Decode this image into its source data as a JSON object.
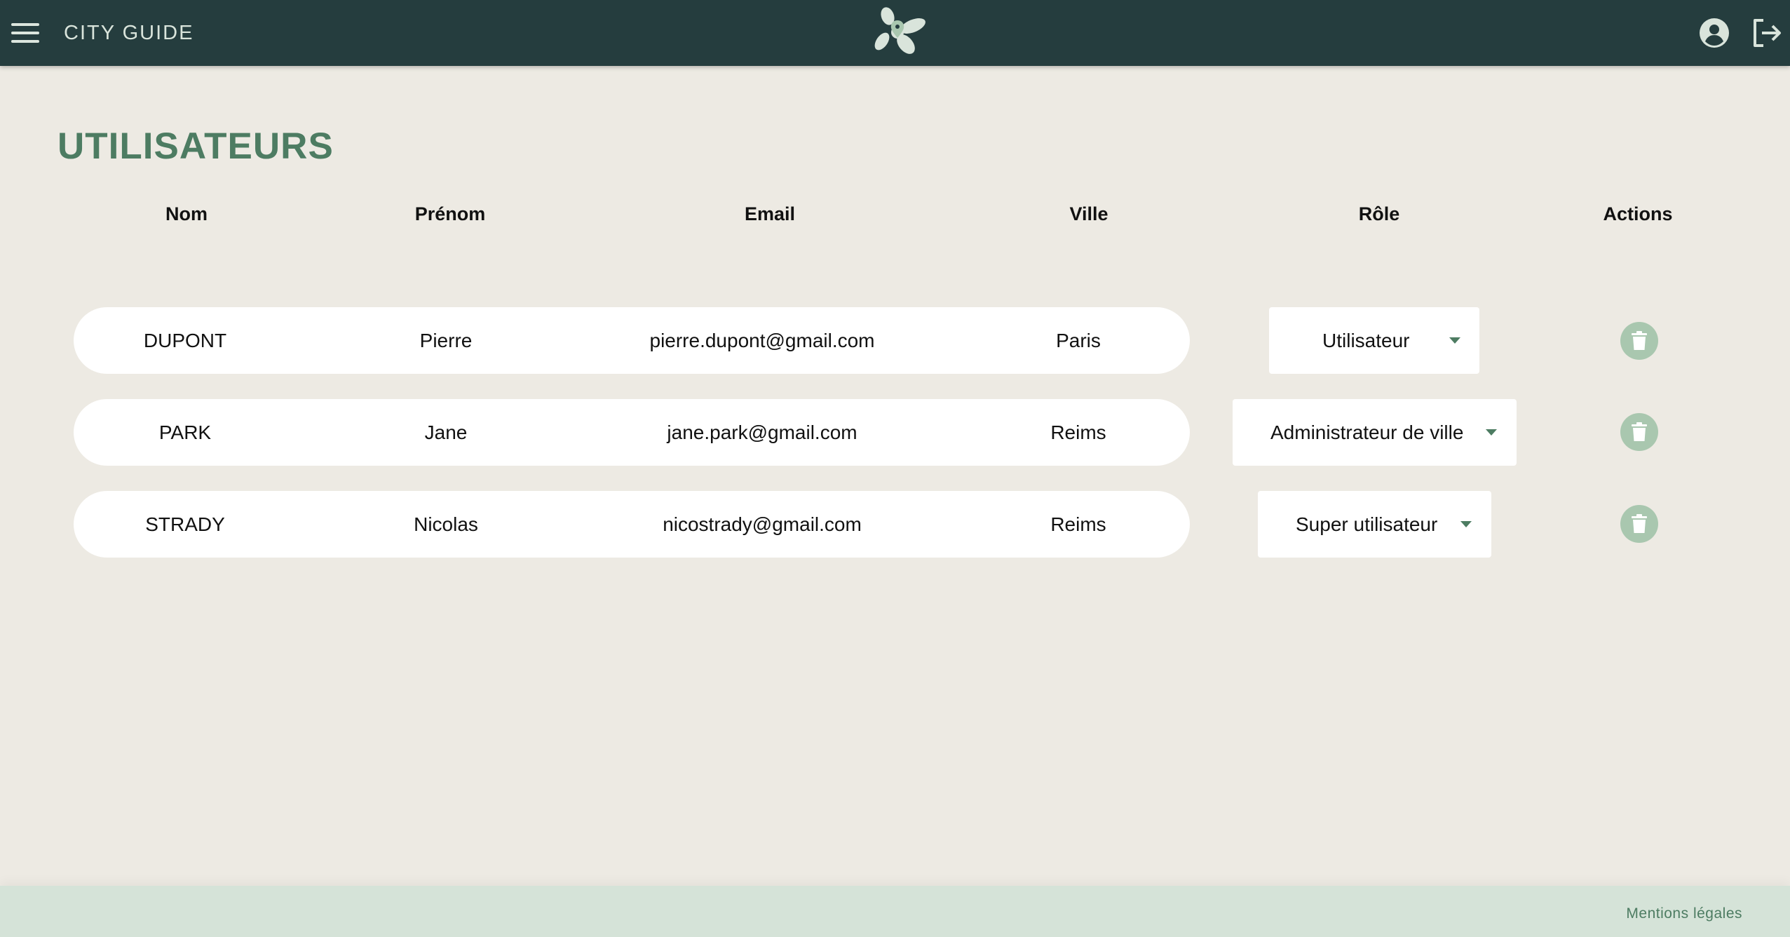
{
  "header": {
    "title": "CITY GUIDE",
    "menu_icon": "hamburger-icon",
    "logo_icon": "flower-pin-logo",
    "profile_icon": "user-circle-icon",
    "logout_icon": "logout-icon"
  },
  "page": {
    "title": "UTILISATEURS"
  },
  "table": {
    "headers": {
      "nom": "Nom",
      "prenom": "Prénom",
      "email": "Email",
      "ville": "Ville",
      "role": "Rôle",
      "actions": "Actions"
    },
    "rows": [
      {
        "nom": "DUPONT",
        "prenom": "Pierre",
        "email": "pierre.dupont@gmail.com",
        "ville": "Paris",
        "role": "Utilisateur"
      },
      {
        "nom": "PARK",
        "prenom": "Jane",
        "email": "jane.park@gmail.com",
        "ville": "Reims",
        "role": "Administrateur de ville"
      },
      {
        "nom": "STRADY",
        "prenom": "Nicolas",
        "email": "nicostrady@gmail.com",
        "ville": "Reims",
        "role": "Super utilisateur"
      }
    ],
    "delete_icon": "trash-icon"
  },
  "footer": {
    "link": "Mentions légales"
  },
  "colors": {
    "header_bg": "#253D3E",
    "accent": "#4D7C62",
    "background": "#EDEAE3",
    "footer_bg": "#D5E3D8",
    "delete_bg": "#A9C7AF"
  }
}
